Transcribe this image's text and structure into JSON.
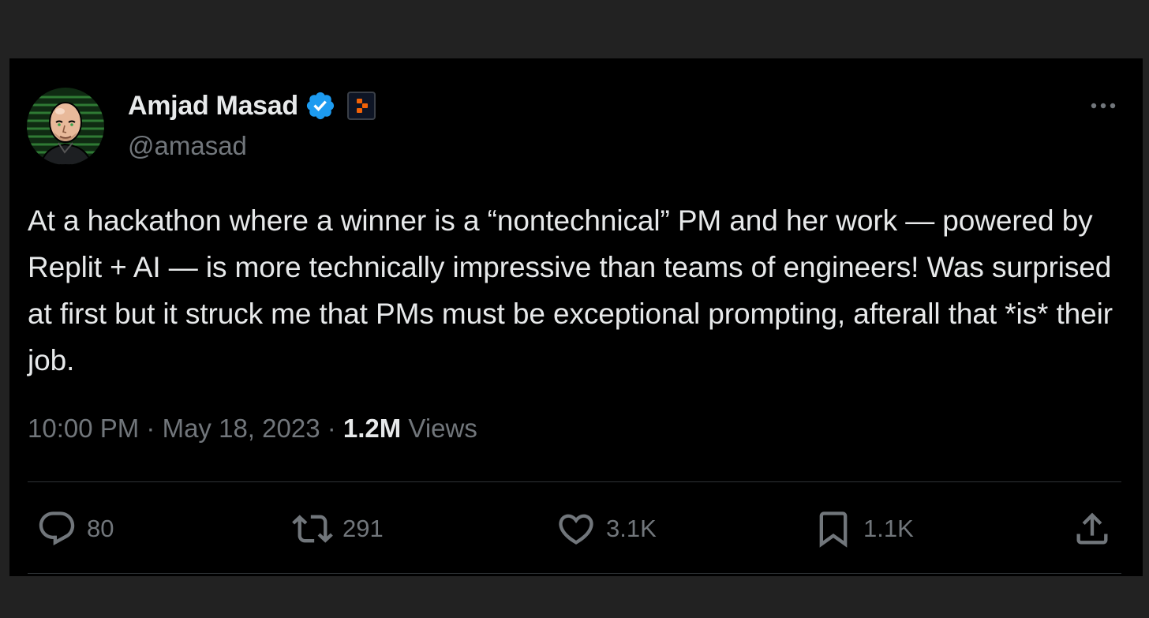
{
  "author": {
    "name": "Amjad Masad",
    "handle": "@amasad",
    "verified_icon": "verified-badge-icon",
    "affiliate_icon": "replit-logo-icon"
  },
  "tweet": {
    "text": "At a hackathon where a winner is a “nontechnical” PM and her work — powered by Replit + AI — is more technically impressive than teams of engineers! Was surprised at first but it struck me that PMs must be exceptional prompting, afterall that *is* their job.",
    "time": "10:00 PM",
    "separator": " · ",
    "date": "May 18, 2023",
    "views_count": "1.2M",
    "views_label": " Views"
  },
  "actions": {
    "replies": "80",
    "reposts": "291",
    "likes": "3.1K",
    "bookmarks": "1.1K"
  },
  "colors": {
    "background": "#000000",
    "outer": "#222222",
    "text_primary": "#e7e9ea",
    "text_secondary": "#71767b",
    "verified_blue": "#1d9bf0",
    "replit_orange": "#f26207",
    "divider": "#2f3336"
  }
}
